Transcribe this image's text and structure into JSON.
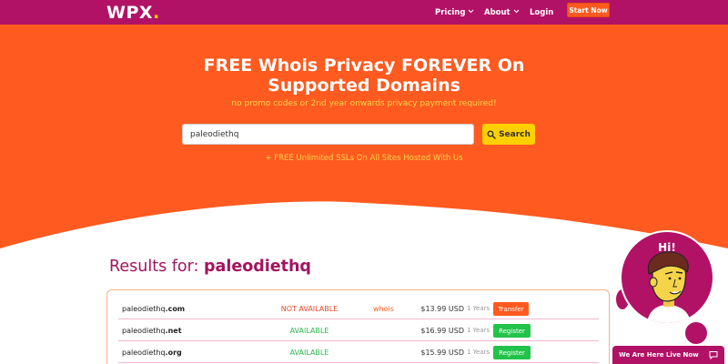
{
  "header": {
    "logo": "WPX",
    "logo_dot": ".",
    "nav": {
      "pricing": "Pricing",
      "about": "About",
      "login": "Login"
    },
    "start_button": "Start Now"
  },
  "hero": {
    "title": "FREE Whois Privacy FOREVER On Supported Domains",
    "subtitle": "no promo codes or 2nd year onwards privacy payment required!",
    "search": {
      "value": "paleodiethq",
      "button_label": "Search"
    },
    "ssl_note": "+ FREE Unlimited SSLs On All Sites Hosted With Us"
  },
  "results": {
    "label": "Results for:",
    "query": "paleodiethq",
    "rows": [
      {
        "name": "paleodiethq",
        "tld": ".com",
        "status": "NOT AVAILABLE",
        "whois": "whois",
        "price": "$13.99 USD",
        "years": "1 Years",
        "action": "Transfer"
      },
      {
        "name": "paleodiethq",
        "tld": ".net",
        "status": "AVAILABLE",
        "whois": "",
        "price": "$16.99 USD",
        "years": "1 Years",
        "action": "Register"
      },
      {
        "name": "paleodiethq",
        "tld": ".org",
        "status": "AVAILABLE",
        "whois": "",
        "price": "$15.99 USD",
        "years": "1 Years",
        "action": "Register"
      }
    ]
  },
  "chat": {
    "greeting": "Hi!",
    "bar_label": "We Are Here Live Now"
  },
  "colors": {
    "brand_magenta": "#b11266",
    "brand_orange": "#ff5a1f",
    "accent_yellow": "#ffd000",
    "available_green": "#2cb84c",
    "not_available_red": "#e84a2a"
  }
}
